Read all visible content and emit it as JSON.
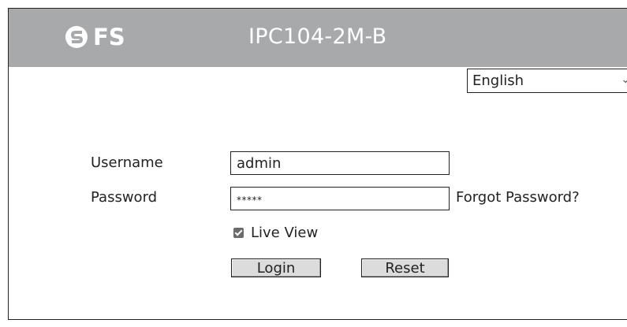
{
  "header": {
    "brand": "FS",
    "model": "IPC104-2M-B",
    "background_color": "#a7a9ab"
  },
  "language": {
    "selected": "English",
    "arrow_icon": "chevron-down-icon"
  },
  "login_form": {
    "username_label": "Username",
    "username_value": "admin",
    "password_label": "Password",
    "password_value": "*****",
    "forgot_password": "Forgot Password?",
    "live_view_label": "Live View",
    "live_view_checked": true,
    "login_button": "Login",
    "reset_button": "Reset"
  }
}
